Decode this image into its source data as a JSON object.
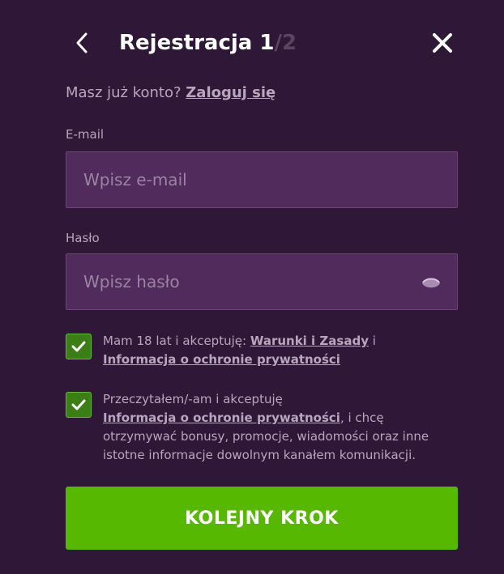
{
  "header": {
    "title_main": "Rejestracja 1",
    "title_total": "/2"
  },
  "login": {
    "prompt": "Masz już konto?",
    "link": "Zaloguj się"
  },
  "email": {
    "label": "E-mail",
    "placeholder": "Wpisz e-mail",
    "value": ""
  },
  "password": {
    "label": "Hasło",
    "placeholder": "Wpisz hasło",
    "value": ""
  },
  "consent_age": {
    "checked": true,
    "text_before": "Mam 18 lat i akceptuję:",
    "link_terms": "Warunki i Zasady",
    "text_and": "i",
    "link_privacy": "Informacja o ochronie prywatności"
  },
  "consent_marketing": {
    "checked": true,
    "text_before": "Przeczytałem/-am i akceptuję",
    "link_privacy": "Informacja o ochronie prywatności",
    "text_after": ", i chcę otrzymywać bonusy, promocje, wiadomości oraz inne istotne informacje dowolnym kanałem komunikacji."
  },
  "submit": {
    "label": "KOLEJNY KROK"
  },
  "colors": {
    "background": "#2f1837",
    "input_background": "#512b5b",
    "accent_green": "#56b800",
    "checkbox_green": "#3c7e16",
    "text_muted": "#b7a6bc"
  },
  "icons": {
    "back": "chevron-left-icon",
    "close": "close-icon",
    "password_toggle": "eye-icon",
    "checkbox": "checkmark-icon"
  }
}
